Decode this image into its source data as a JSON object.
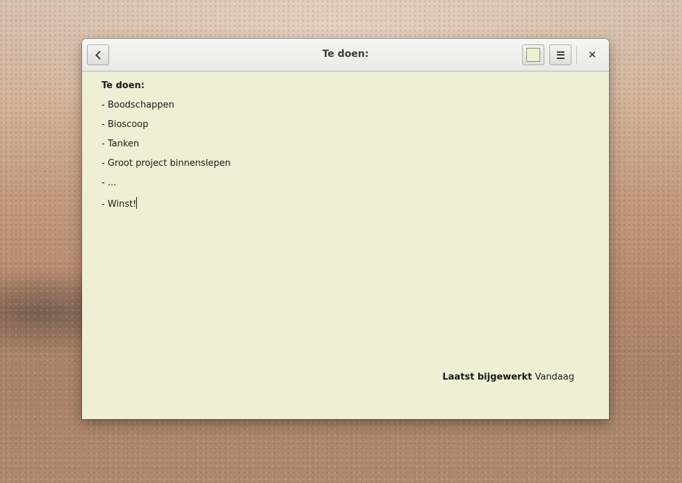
{
  "window": {
    "title": "Te doen:"
  },
  "toolbar": {
    "back_icon": "chevron-left-icon",
    "color_swatch": "#eef1d0",
    "menu_icon": "hamburger-icon",
    "close_label": "✕"
  },
  "note": {
    "lines": [
      "Te doen:",
      "- Boodschappen",
      "- Bioscoop",
      "- Tanken",
      "- Groot project binnenslepen",
      "- ...",
      "- Winst!"
    ],
    "background": "#edf0d3"
  },
  "footer": {
    "label": "Laatst bijgewerkt",
    "value": "Vandaag"
  }
}
